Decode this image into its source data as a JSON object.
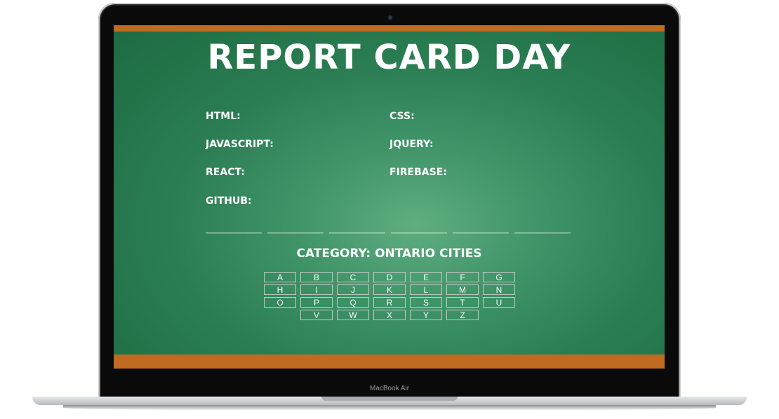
{
  "device": {
    "label": "MacBook Air"
  },
  "page": {
    "title": "REPORT CARD DAY",
    "skills": {
      "html": "HTML:",
      "css": "CSS:",
      "javascript": "JAVASCRIPT:",
      "jquery": "JQUERY:",
      "react": "REACT:",
      "firebase": "FIREBASE:",
      "github": "GITHUB:"
    },
    "blank_count": 6,
    "category": "CATEGORY: ONTARIO CITIES",
    "letters": [
      "A",
      "B",
      "C",
      "D",
      "E",
      "F",
      "G",
      "H",
      "I",
      "J",
      "K",
      "L",
      "M",
      "N",
      "O",
      "P",
      "Q",
      "R",
      "S",
      "T",
      "U",
      "V",
      "W",
      "X",
      "Y",
      "Z"
    ]
  },
  "colors": {
    "chalkboard": "#2a7d52",
    "wood_trim": "#c06a22",
    "chalk": "#ffffff"
  }
}
